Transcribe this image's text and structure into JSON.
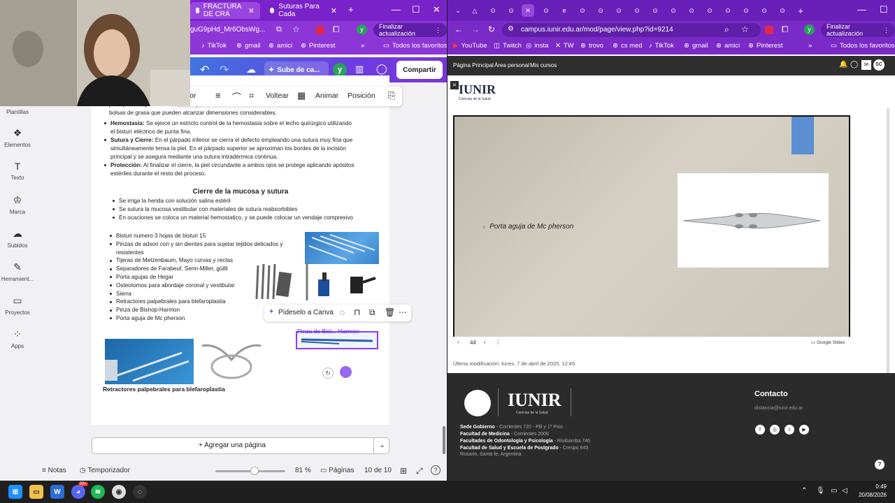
{
  "left": {
    "tabs": [
      {
        "label": "FRACTURA DE CRÁ",
        "active": true
      },
      {
        "label": "Suturas Para Cada",
        "active": false
      }
    ],
    "address": "guG9pHd_Mr6ObsWg...",
    "finalize_update": "Finalizar actualización",
    "profile_letter": "y",
    "bookmarks": [
      "TikTok",
      "gmail",
      "amici",
      "Pinterest"
    ],
    "all_favorites": "Todos los favoritos",
    "canva": {
      "undo": "↶",
      "redo": "↷",
      "upload_label": "Sube de ca...",
      "avatar": "y",
      "share": "Compartir",
      "toolbar": {
        "crop_label": "rador",
        "flip": "Voltear",
        "animate": "Animar",
        "position": "Posición"
      },
      "sidebar": [
        "Plantillas",
        "Elementos",
        "Texto",
        "Marca",
        "Subidos",
        "Herramient...",
        "Proyectos",
        "Apps"
      ],
      "intro_lines": [
        "justo por debajo de la línea de las pestañas. A través de esta incisión subciliar se extraen las",
        "bolsas de grasa que pueden alcanzar dimensiones considerables."
      ],
      "procedure": [
        {
          "term": "Hemostasia:",
          "lines": [
            "Se ejerce un estricto control de la hemostasia sobre el lecho quirúrgico utilizando",
            "el bisturí eléctrico de punta fina."
          ]
        },
        {
          "term": "Sutura y Cierre:",
          "lines": [
            "En el párpado inferior se cierra el defecto empleando una sutura muy fina que",
            "simultáneamente tensa la piel. En el párpado superior se aproximan los bordes de la incisión",
            "principal y se asegura mediante una sutura intradérmica continua."
          ]
        },
        {
          "term": "Protección:",
          "lines": [
            "Al finalizar el cierre, la piel circundante a ambos ojos se protege aplicando apósitos",
            "estériles durante el resto del proceso."
          ]
        }
      ],
      "closure_heading": "Cierre de la mucosa y sutura",
      "closure_items": [
        "Se irriga la herida con solución salina estéril",
        "Se sutura la mucosa vestibular con materiales de sutura reabsorbibles",
        "En ocaciones se coloca un material hemostatico, y se puede colocar un vendaje compresivo"
      ],
      "instruments": [
        "Bisturi numero 3 hojas de bisturi 15",
        "Pinzas de adson con y sin dientes para sujetar tejidos delicados y",
        "resistentes",
        "Tijeras de Metzenbaum, Mayo curvas y rectas",
        "Separadores de Farabeuf, Senn-Miller, güilli",
        "Porta agujas de Hegar",
        "Osteotomos para abordaje coronal y vestibular",
        "Sierra",
        "Retractores palpebrales para blefaroplastia",
        "Pinza de Bishop-Harmon",
        "Porta aguja de Mc pherson"
      ],
      "pideselo": "Pídeselo a Canva",
      "selected_caption": "Pinza de Bisl... Harmon",
      "retractor_caption": "Retractores palpebrales para blefaroplastia",
      "add_page": "+ Agregar una página",
      "footer": {
        "notes": "Notas",
        "timer": "Temporizador",
        "zoom": "81 %",
        "pages": "Páginas",
        "page_count": "10 de 10"
      }
    }
  },
  "right": {
    "address": "campus.iunir.edu.ar/mod/page/view.php?id=9214",
    "finalize_update": "Finalizar actualización",
    "profile_letter": "y",
    "bookmarks": [
      "YouTube",
      "Twitch",
      "insta",
      "TW",
      "trovo",
      "cs med",
      "TikTok",
      "gmail",
      "amici",
      "Pinterest"
    ],
    "all_favorites": "Todos los favoritos",
    "nav": [
      "Página Principal",
      "Área personal",
      "Mis cursos"
    ],
    "user_initials": "SC",
    "logo": "IUNIR",
    "logo_sub": "Ciencias de la Salud",
    "slide_text": "Porta aguja de Mc pherson",
    "slide_page": "44",
    "google_slides": "Google Slides",
    "last_modified": "Última modificación: lunes, 7 de abril de 2025, 12:45",
    "contact_title": "Contacto",
    "contact_email": "distancia@iunir.edu.ar",
    "footer_lines": [
      {
        "bold": "Sede Gobierno",
        "text": " - Corrientes 720 - PB y 1º Piso"
      },
      {
        "bold": "Facultad de Medicina",
        "text": " - Corrientes 2009"
      },
      {
        "bold": "Facultades de Odontología y Psicología",
        "text": " - Rioibamba 746"
      },
      {
        "bold": "Facultad de Salud y Escuela de Postgrado",
        "text": " - Crespo 843"
      },
      {
        "bold": "",
        "text": "Rosario, Santa fe, Argentina"
      }
    ]
  },
  "taskbar": {
    "time": "0:49",
    "date": "20/08/2026",
    "discord_badge": "99+"
  }
}
